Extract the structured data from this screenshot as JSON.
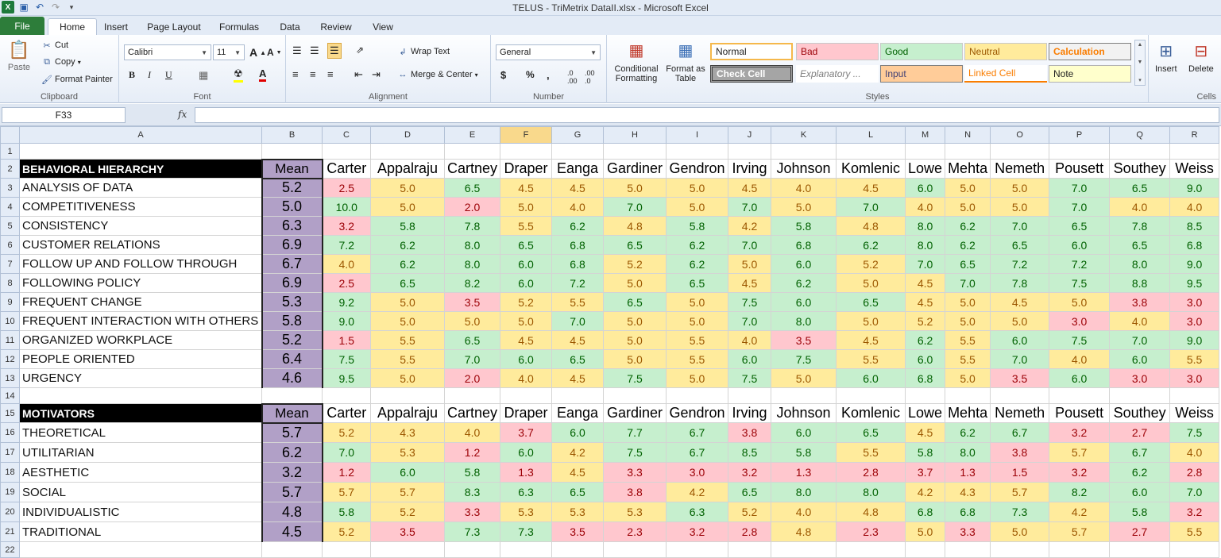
{
  "window": {
    "title": "TELUS - TriMetrix DataII.xlsx  -  Microsoft Excel"
  },
  "tabs": [
    "File",
    "Home",
    "Insert",
    "Page Layout",
    "Formulas",
    "Data",
    "Review",
    "View"
  ],
  "ribbon": {
    "clipboard": {
      "paste": "Paste",
      "cut": "Cut",
      "copy": "Copy",
      "format_painter": "Format Painter",
      "label": "Clipboard"
    },
    "font": {
      "name": "Calibri",
      "size": "11",
      "label": "Font"
    },
    "alignment": {
      "wrap": "Wrap Text",
      "merge": "Merge & Center",
      "label": "Alignment"
    },
    "number": {
      "format": "General",
      "label": "Number"
    },
    "styles": {
      "conditional": "Conditional Formatting",
      "format_table": "Format as Table",
      "cells": [
        {
          "label": "Normal",
          "cls": "normal"
        },
        {
          "label": "Bad",
          "cls": "bad"
        },
        {
          "label": "Good",
          "cls": "good"
        },
        {
          "label": "Neutral",
          "cls": "neutral"
        },
        {
          "label": "Calculation",
          "cls": "calc"
        },
        {
          "label": "Check Cell",
          "cls": "check"
        },
        {
          "label": "Explanatory ...",
          "cls": "expl"
        },
        {
          "label": "Input",
          "cls": "input"
        },
        {
          "label": "Linked Cell",
          "cls": "linked"
        },
        {
          "label": "Note",
          "cls": "note"
        }
      ],
      "label": "Styles"
    },
    "cells": {
      "insert": "Insert",
      "delete": "Delete",
      "label": "Cells"
    }
  },
  "formula_bar": {
    "name_box": "F33",
    "fx": "fx",
    "content": ""
  },
  "grid": {
    "columns": [
      "A",
      "B",
      "C",
      "D",
      "E",
      "F",
      "G",
      "H",
      "I",
      "J",
      "K",
      "L",
      "M",
      "N",
      "O",
      "P",
      "Q",
      "R"
    ],
    "selected_column": "F",
    "names": [
      "Carter",
      "Appalraju",
      "Cartney",
      "Draper",
      "Eanga",
      "Gardiner",
      "Gendron",
      "Irving",
      "Johnson",
      "Komlenic",
      "Lowe",
      "Mehta",
      "Nemeth",
      "Pousett",
      "Southey",
      "Weiss"
    ],
    "section1": {
      "title": "BEHAVIORAL HIERARCHY",
      "mean_label": "Mean",
      "rows": [
        {
          "label": "ANALYSIS OF DATA",
          "mean": "5.2",
          "values": [
            "2.5",
            "5.0",
            "6.5",
            "4.5",
            "4.5",
            "5.0",
            "5.0",
            "4.5",
            "4.0",
            "4.5",
            "6.0",
            "5.0",
            "5.0",
            "7.0",
            "6.5",
            "9.0"
          ]
        },
        {
          "label": "COMPETITIVENESS",
          "mean": "5.0",
          "values": [
            "10.0",
            "5.0",
            "2.0",
            "5.0",
            "4.0",
            "7.0",
            "5.0",
            "7.0",
            "5.0",
            "7.0",
            "4.0",
            "5.0",
            "5.0",
            "7.0",
            "4.0",
            "4.0"
          ]
        },
        {
          "label": "CONSISTENCY",
          "mean": "6.3",
          "values": [
            "3.2",
            "5.8",
            "7.8",
            "5.5",
            "6.2",
            "4.8",
            "5.8",
            "4.2",
            "5.8",
            "4.8",
            "8.0",
            "6.2",
            "7.0",
            "6.5",
            "7.8",
            "8.5"
          ]
        },
        {
          "label": "CUSTOMER RELATIONS",
          "mean": "6.9",
          "values": [
            "7.2",
            "6.2",
            "8.0",
            "6.5",
            "6.8",
            "6.5",
            "6.2",
            "7.0",
            "6.8",
            "6.2",
            "8.0",
            "6.2",
            "6.5",
            "6.0",
            "6.5",
            "6.8"
          ]
        },
        {
          "label": "FOLLOW UP AND FOLLOW THROUGH",
          "mean": "6.7",
          "values": [
            "4.0",
            "6.2",
            "8.0",
            "6.0",
            "6.8",
            "5.2",
            "6.2",
            "5.0",
            "6.0",
            "5.2",
            "7.0",
            "6.5",
            "7.2",
            "7.2",
            "8.0",
            "9.0"
          ]
        },
        {
          "label": "FOLLOWING POLICY",
          "mean": "6.9",
          "values": [
            "2.5",
            "6.5",
            "8.2",
            "6.0",
            "7.2",
            "5.0",
            "6.5",
            "4.5",
            "6.2",
            "5.0",
            "4.5",
            "7.0",
            "7.8",
            "7.5",
            "8.8",
            "9.5"
          ]
        },
        {
          "label": "FREQUENT CHANGE",
          "mean": "5.3",
          "values": [
            "9.2",
            "5.0",
            "3.5",
            "5.2",
            "5.5",
            "6.5",
            "5.0",
            "7.5",
            "6.0",
            "6.5",
            "4.5",
            "5.0",
            "4.5",
            "5.0",
            "3.8",
            "3.0"
          ]
        },
        {
          "label": "FREQUENT INTERACTION WITH OTHERS",
          "mean": "5.8",
          "values": [
            "9.0",
            "5.0",
            "5.0",
            "5.0",
            "7.0",
            "5.0",
            "5.0",
            "7.0",
            "8.0",
            "5.0",
            "5.2",
            "5.0",
            "5.0",
            "3.0",
            "4.0",
            "3.0"
          ]
        },
        {
          "label": "ORGANIZED WORKPLACE",
          "mean": "5.2",
          "values": [
            "1.5",
            "5.5",
            "6.5",
            "4.5",
            "4.5",
            "5.0",
            "5.5",
            "4.0",
            "3.5",
            "4.5",
            "6.2",
            "5.5",
            "6.0",
            "7.5",
            "7.0",
            "9.0"
          ]
        },
        {
          "label": "PEOPLE ORIENTED",
          "mean": "6.4",
          "values": [
            "7.5",
            "5.5",
            "7.0",
            "6.0",
            "6.5",
            "5.0",
            "5.5",
            "6.0",
            "7.5",
            "5.5",
            "6.0",
            "5.5",
            "7.0",
            "4.0",
            "6.0",
            "5.5"
          ]
        },
        {
          "label": "URGENCY",
          "mean": "4.6",
          "values": [
            "9.5",
            "5.0",
            "2.0",
            "4.0",
            "4.5",
            "7.5",
            "5.0",
            "7.5",
            "5.0",
            "6.0",
            "6.8",
            "5.0",
            "3.5",
            "6.0",
            "3.0",
            "3.0"
          ]
        }
      ]
    },
    "section2": {
      "title": "MOTIVATORS",
      "mean_label": "Mean",
      "rows": [
        {
          "label": "THEORETICAL",
          "mean": "5.7",
          "values": [
            "5.2",
            "4.3",
            "4.0",
            "3.7",
            "6.0",
            "7.7",
            "6.7",
            "3.8",
            "6.0",
            "6.5",
            "4.5",
            "6.2",
            "6.7",
            "3.2",
            "2.7",
            "7.5"
          ]
        },
        {
          "label": "UTILITARIAN",
          "mean": "6.2",
          "values": [
            "7.0",
            "5.3",
            "1.2",
            "6.0",
            "4.2",
            "7.5",
            "6.7",
            "8.5",
            "5.8",
            "5.5",
            "5.8",
            "8.0",
            "3.8",
            "5.7",
            "6.7",
            "4.0"
          ]
        },
        {
          "label": "AESTHETIC",
          "mean": "3.2",
          "values": [
            "1.2",
            "6.0",
            "5.8",
            "1.3",
            "4.5",
            "3.3",
            "3.0",
            "3.2",
            "1.3",
            "2.8",
            "3.7",
            "1.3",
            "1.5",
            "3.2",
            "6.2",
            "2.8"
          ]
        },
        {
          "label": "SOCIAL",
          "mean": "5.7",
          "values": [
            "5.7",
            "5.7",
            "8.3",
            "6.3",
            "6.5",
            "3.8",
            "4.2",
            "6.5",
            "8.0",
            "8.0",
            "4.2",
            "4.3",
            "5.7",
            "8.2",
            "6.0",
            "7.0"
          ]
        },
        {
          "label": "INDIVIDUALISTIC",
          "mean": "4.8",
          "values": [
            "5.8",
            "5.2",
            "3.3",
            "5.3",
            "5.3",
            "5.3",
            "6.3",
            "5.2",
            "4.0",
            "4.8",
            "6.8",
            "6.8",
            "7.3",
            "4.2",
            "5.8",
            "3.2"
          ]
        },
        {
          "label": "TRADITIONAL",
          "mean": "4.5",
          "values": [
            "5.2",
            "3.5",
            "7.3",
            "7.3",
            "3.5",
            "2.3",
            "3.2",
            "2.8",
            "4.8",
            "2.3",
            "5.0",
            "3.3",
            "5.0",
            "5.7",
            "2.7",
            "5.5"
          ]
        }
      ]
    },
    "colors": {
      "good_fill": "#c6efce",
      "good_text": "#006100",
      "bad_fill": "#ffc7ce",
      "bad_text": "#9c0006",
      "neutral_fill": "#ffeb9c",
      "neutral_text": "#9c5700",
      "mean_fill": "#b1a0c7"
    }
  }
}
